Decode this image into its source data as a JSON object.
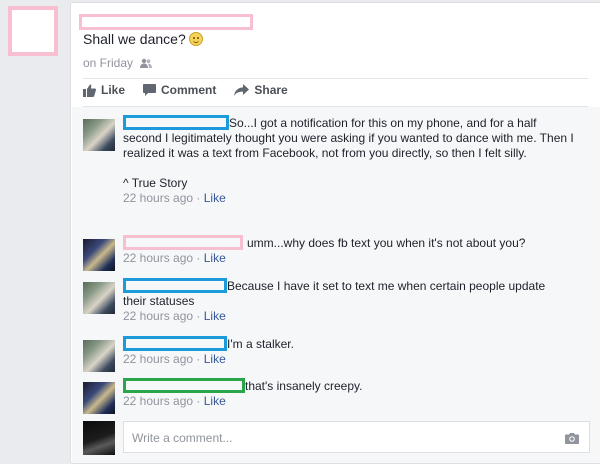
{
  "post": {
    "text": "Shall we dance?",
    "meta": "on Friday"
  },
  "actions": {
    "like": "Like",
    "comment": "Comment",
    "share": "Share"
  },
  "comments": [
    {
      "line1": "So...I got a notification for this on my phone, and for a half",
      "rest": "second I legitimately thought you were asking if you wanted to dance with me. Then I realized it was a text from Facebook, not from you directly, so then I felt silly.",
      "footer": "^ True Story",
      "time": "22 hours ago",
      "like": "Like"
    },
    {
      "line1": "umm...why does fb text you when it's not about you?",
      "time": "22 hours ago",
      "like": "Like"
    },
    {
      "line1": "Because I have it set to text me when certain people update",
      "rest": "their statuses",
      "time": "22 hours ago",
      "like": "Like"
    },
    {
      "line1": "I'm a stalker.",
      "time": "22 hours ago",
      "like": "Like"
    },
    {
      "line1": "that's insanely creepy.",
      "time": "22 hours ago",
      "like": "Like"
    }
  ],
  "compose": {
    "placeholder": "Write a comment..."
  },
  "colors": {
    "link": "#365899",
    "redaction_pink": "#f7bfd0",
    "redaction_blue": "#1b9bd9",
    "redaction_green": "#2aa64a"
  },
  "icons": [
    "smiley-emoji-icon",
    "friends-audience-icon",
    "thumbs-up-icon",
    "comment-bubble-icon",
    "share-arrow-icon",
    "camera-icon"
  ]
}
